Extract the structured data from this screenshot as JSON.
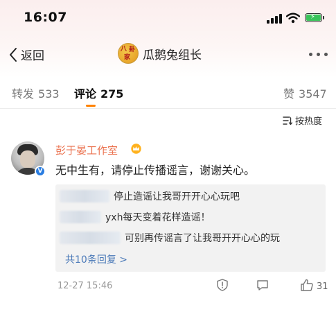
{
  "status_bar": {
    "time": "16:07"
  },
  "nav": {
    "back_label": "返回",
    "title": "瓜鹅兔组长",
    "avatar_chars": [
      "八",
      "卦",
      "家"
    ]
  },
  "tabs": [
    {
      "label": "转发",
      "count": "533"
    },
    {
      "label": "评论",
      "count": "275"
    },
    {
      "label": "赞",
      "count": "3547"
    }
  ],
  "sort": {
    "label": "按热度"
  },
  "comment": {
    "author": "彭于晏工作室",
    "text": "无中生有，请停止传播谣言，谢谢关心。",
    "time": "12-27 15:46",
    "like_count": "31",
    "replies": [
      {
        "text": "停止造谣让我哥开开心心玩吧"
      },
      {
        "text": "yxh每天变着花样造谣！"
      },
      {
        "text": "可别再传谣言了让我哥开开心心的玩"
      }
    ],
    "more_replies": "共10条回复 >"
  },
  "colors": {
    "accent": "#ff8200",
    "username": "#eb7350",
    "link": "#4a79b8",
    "verified": "#2a7de1"
  },
  "icons": [
    "signal-icon",
    "wifi-icon",
    "battery-icon",
    "back-chevron-icon",
    "more-icon",
    "sort-icon",
    "crown-icon",
    "verified-icon",
    "shield-icon",
    "reply-icon",
    "like-icon"
  ]
}
